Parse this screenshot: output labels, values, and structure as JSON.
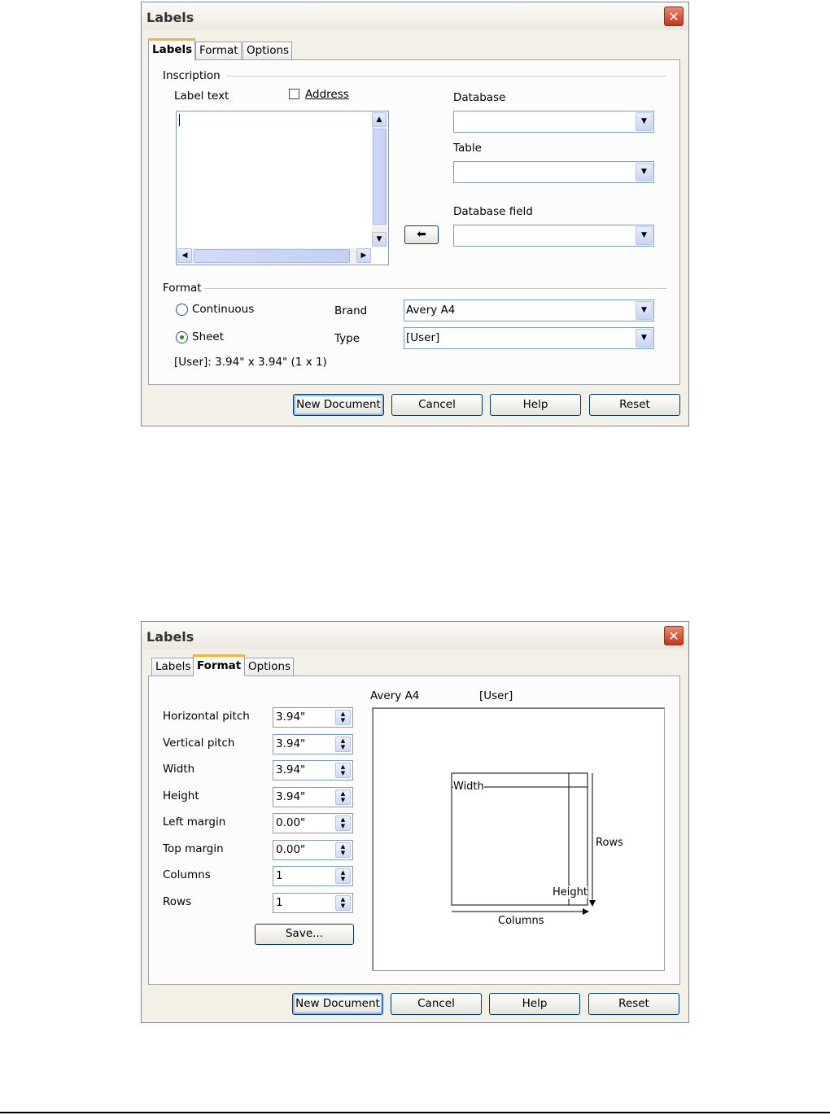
{
  "dialog1": {
    "title": "Labels",
    "tabs": [
      "Labels",
      "Format",
      "Options"
    ],
    "active_tab": "Labels",
    "inscription": {
      "group_label": "Inscription",
      "label_text_label": "Label text",
      "address_label": "Address",
      "address_checked": false,
      "label_text_value": ""
    },
    "database": {
      "label": "Database",
      "value": ""
    },
    "table": {
      "label": "Table",
      "value": ""
    },
    "database_field": {
      "label": "Database field",
      "value": ""
    },
    "format": {
      "group_label": "Format",
      "continuous_label": "Continuous",
      "sheet_label": "Sheet",
      "selected": "Sheet",
      "brand_label": "Brand",
      "brand_value": "Avery A4",
      "type_label": "Type",
      "type_value": "[User]",
      "summary": "[User]: 3.94\" x 3.94\" (1 x 1)"
    },
    "buttons": {
      "new_document": "New Document",
      "cancel": "Cancel",
      "help": "Help",
      "reset": "Reset"
    }
  },
  "dialog2": {
    "title": "Labels",
    "tabs": [
      "Labels",
      "Format",
      "Options"
    ],
    "active_tab": "Format",
    "fields": [
      {
        "label": "Horizontal pitch",
        "value": "3.94\""
      },
      {
        "label": "Vertical pitch",
        "value": "3.94\""
      },
      {
        "label": "Width",
        "value": "3.94\""
      },
      {
        "label": "Height",
        "value": "3.94\""
      },
      {
        "label": "Left margin",
        "value": "0.00\""
      },
      {
        "label": "Top margin",
        "value": "0.00\""
      },
      {
        "label": "Columns",
        "value": "1"
      },
      {
        "label": "Rows",
        "value": "1"
      }
    ],
    "save_button": "Save...",
    "preview": {
      "brand": "Avery A4",
      "type": "[User]",
      "width_label": "Width",
      "height_label": "Height",
      "rows_label": "Rows",
      "columns_label": "Columns"
    },
    "buttons": {
      "new_document": "New Document",
      "cancel": "Cancel",
      "help": "Help",
      "reset": "Reset"
    }
  }
}
